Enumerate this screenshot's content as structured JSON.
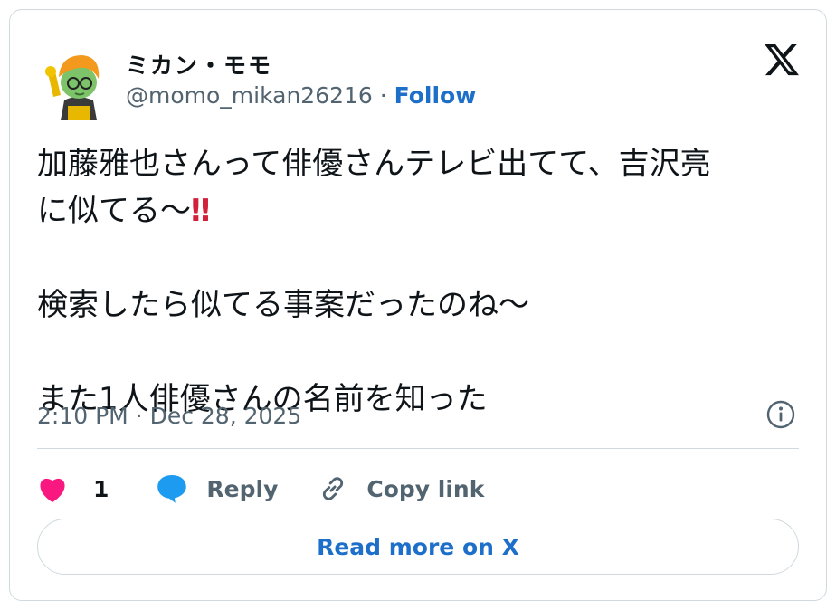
{
  "author": {
    "display_name": "ミカン・モモ",
    "handle": "@momo_mikan26216",
    "separator": " · ",
    "follow_label": "Follow"
  },
  "tweet": {
    "line1": "加藤雅也さんって俳優さんテレビ出てて、吉沢亮",
    "line2": "に似てる〜",
    "emphasis": "‼",
    "line3": "検索したら似てる事案だったのね〜",
    "line4": "また1人俳優さんの名前を知った"
  },
  "timestamp": "2:10 PM · Dec 28, 2025",
  "actions": {
    "like_count": "1",
    "reply_label": "Reply",
    "copy_label": "Copy link"
  },
  "read_more_label": "Read more on X",
  "icons": {
    "logo": "x-logo-icon",
    "info": "info-icon",
    "like": "heart-icon",
    "reply": "speech-bubble-icon",
    "copy": "link-icon"
  },
  "colors": {
    "link": "#1d6fc9",
    "heart": "#f91880",
    "reply_bubble": "#1d9bf0",
    "muted_text": "#536471",
    "border": "#cfd9de",
    "emphasis": "#d3213c"
  }
}
